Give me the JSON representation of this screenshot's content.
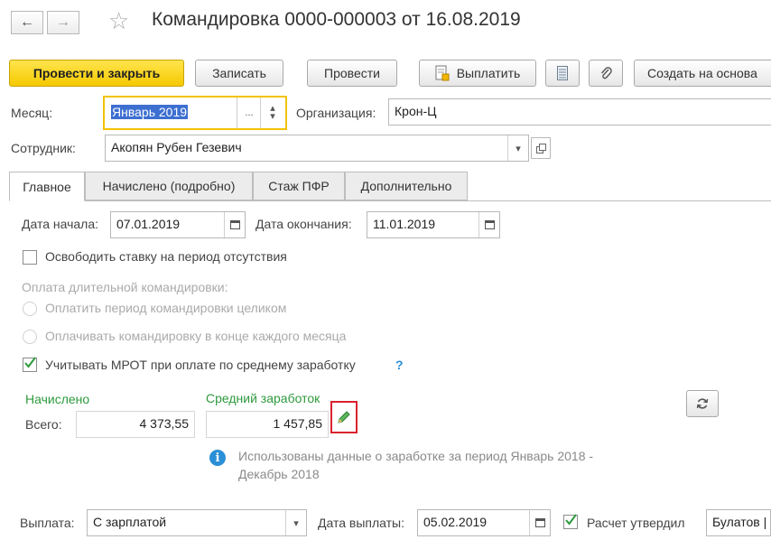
{
  "window": {
    "back_icon": "←",
    "forward_icon": "→",
    "star_icon": "☆",
    "title": "Командировка 0000-000003 от 16.08.2019"
  },
  "toolbar": {
    "post_close": "Провести и закрыть",
    "save": "Записать",
    "post": "Провести",
    "pay": "Выплатить",
    "create_based": "Создать на основа"
  },
  "header": {
    "month_label": "Месяц:",
    "month_value": "Январь 2019",
    "month_ellipsis": "...",
    "org_label": "Организация:",
    "org_value": "Крон-Ц",
    "employee_label": "Сотрудник:",
    "employee_value": "Акопян Рубен Гезевич"
  },
  "tabs": [
    {
      "label": "Главное"
    },
    {
      "label": "Начислено (подробно)"
    },
    {
      "label": "Стаж ПФР"
    },
    {
      "label": "Дополнительно"
    }
  ],
  "main": {
    "start_label": "Дата начала:",
    "start_value": "07.01.2019",
    "end_label": "Дата окончания:",
    "end_value": "11.01.2019",
    "release_rate": "Освободить ставку на период отсутствия",
    "long_trip_label": "Оплата длительной командировки:",
    "pay_whole": "Оплатить период командировки целиком",
    "pay_monthly": "Оплачивать командировку в конце каждого месяца",
    "mrot": "Учитывать МРОТ при оплате по среднему заработку",
    "help": "?",
    "accrued_label": "Начислено",
    "avg_label": "Средний заработок",
    "total_label": "Всего:",
    "total_value": "4 373,55",
    "avg_value": "1 457,85",
    "info_icon": "i",
    "info_text_1": "Использованы данные о заработке за период Январь 2018 -",
    "info_text_2": "Декабрь 2018"
  },
  "footer": {
    "payout_label": "Выплата:",
    "payout_value": "С зарплатой",
    "pay_date_label": "Дата выплаты:",
    "pay_date_value": "05.02.2019",
    "approved_label": "Расчет утвердил",
    "approved_value": "Булатов |"
  },
  "colors": {
    "primary_button": "#f5c900",
    "focus_border": "#f2c200",
    "accent_green": "#2e9a3e",
    "highlight_red": "#d9232e",
    "info_blue": "#2a8fd6"
  }
}
